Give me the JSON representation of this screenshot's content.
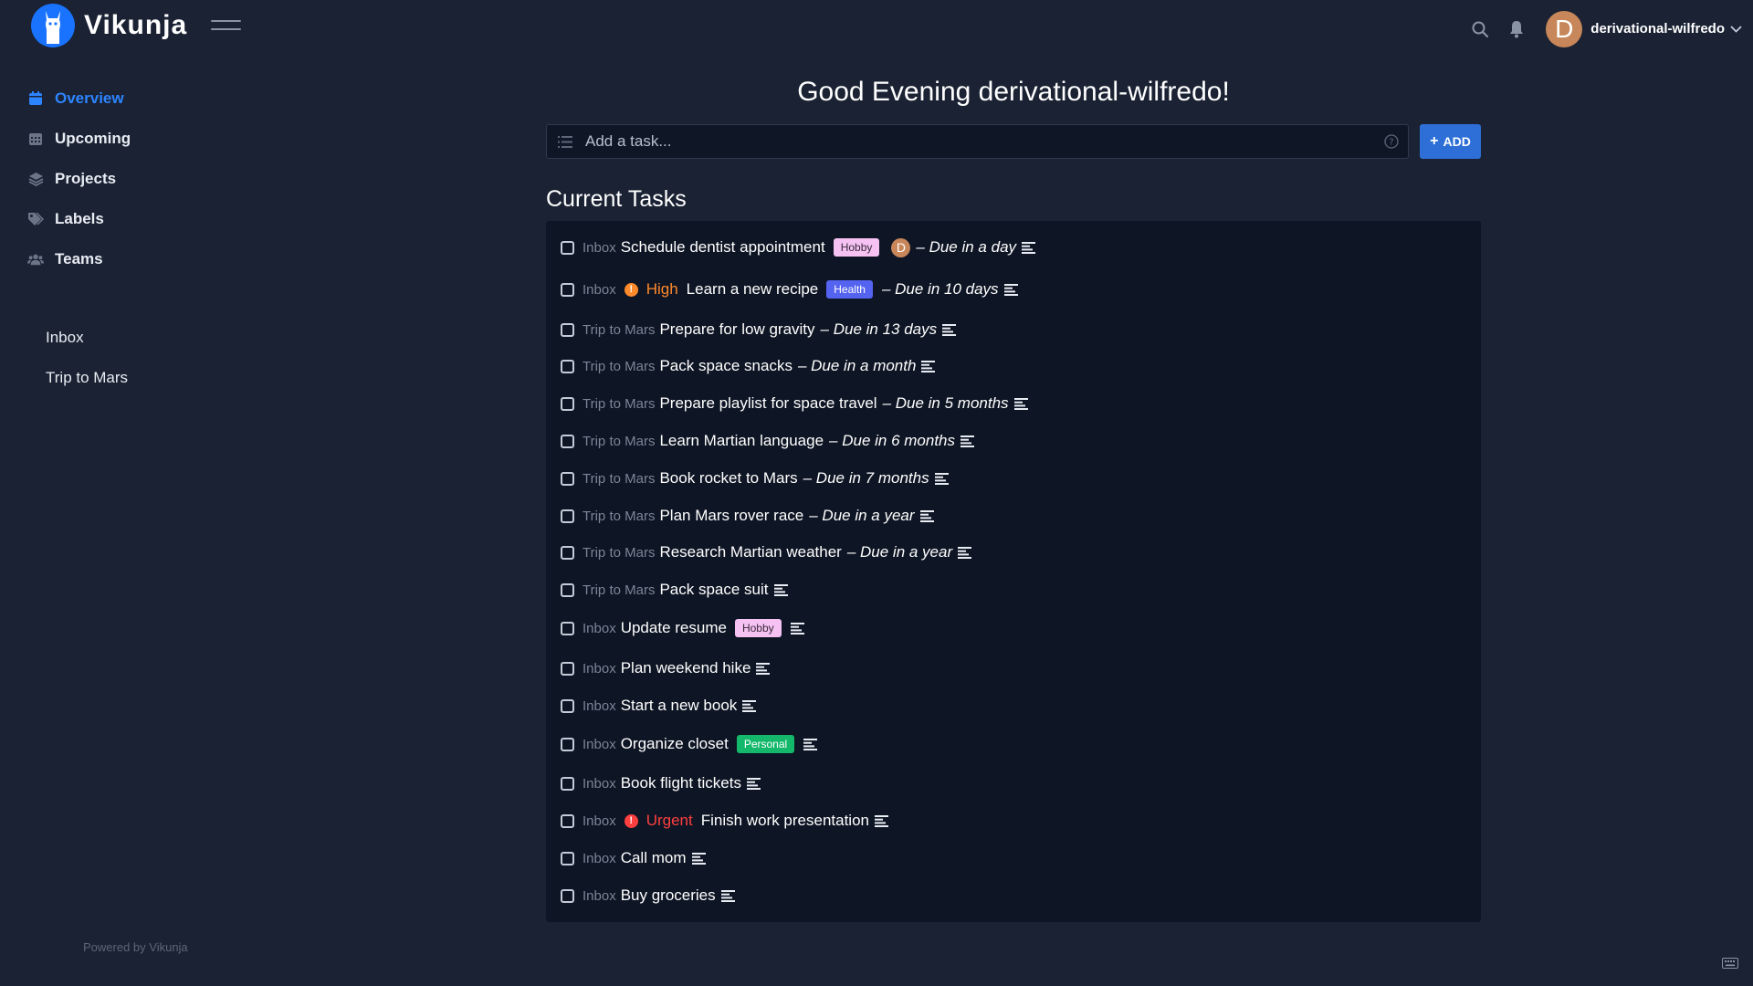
{
  "app": {
    "name": "Vikunja"
  },
  "header": {
    "username": "derivational-wilfredo",
    "avatar_letter": "D",
    "avatar_color": "#c8875a"
  },
  "nav": [
    {
      "label": "Overview",
      "icon": "calendar-icon",
      "active": true
    },
    {
      "label": "Upcoming",
      "icon": "calendar-grid-icon",
      "active": false
    },
    {
      "label": "Projects",
      "icon": "layers-icon",
      "active": false
    },
    {
      "label": "Labels",
      "icon": "tags-icon",
      "active": false
    },
    {
      "label": "Teams",
      "icon": "users-icon",
      "active": false
    }
  ],
  "projects": [
    {
      "label": "Inbox"
    },
    {
      "label": "Trip to Mars"
    }
  ],
  "footer": {
    "powered": "Powered by Vikunja"
  },
  "main": {
    "greeting": "Good Evening derivational-wilfredo!",
    "add_placeholder": "Add a task...",
    "add_button": "ADD",
    "section_title": "Current Tasks"
  },
  "colors": {
    "accent": "#2d84ff",
    "priority_high": "#ff8a2b",
    "priority_urgent": "#ff4040",
    "label_hobby": "#f5c2f3",
    "label_health": "#5463f0",
    "label_personal": "#14b86a"
  },
  "tasks": [
    {
      "project": "Inbox",
      "title": "Schedule dentist appointment",
      "label": "Hobby",
      "assignee": "D",
      "due": "– Due in a day"
    },
    {
      "project": "Inbox",
      "priority": "High",
      "title": "Learn a new recipe",
      "label": "Health",
      "due": "– Due in 10 days"
    },
    {
      "project": "Trip to Mars",
      "title": "Prepare for low gravity",
      "due": "– Due in 13 days"
    },
    {
      "project": "Trip to Mars",
      "title": "Pack space snacks",
      "due": "– Due in a month"
    },
    {
      "project": "Trip to Mars",
      "title": "Prepare playlist for space travel",
      "due": "– Due in 5 months"
    },
    {
      "project": "Trip to Mars",
      "title": "Learn Martian language",
      "due": "– Due in 6 months"
    },
    {
      "project": "Trip to Mars",
      "title": "Book rocket to Mars",
      "due": "– Due in 7 months"
    },
    {
      "project": "Trip to Mars",
      "title": "Plan Mars rover race",
      "due": "– Due in a year"
    },
    {
      "project": "Trip to Mars",
      "title": "Research Martian weather",
      "due": "– Due in a year"
    },
    {
      "project": "Trip to Mars",
      "title": "Pack space suit"
    },
    {
      "project": "Inbox",
      "title": "Update resume",
      "label": "Hobby"
    },
    {
      "project": "Inbox",
      "title": "Plan weekend hike"
    },
    {
      "project": "Inbox",
      "title": "Start a new book"
    },
    {
      "project": "Inbox",
      "title": "Organize closet",
      "label": "Personal"
    },
    {
      "project": "Inbox",
      "title": "Book flight tickets"
    },
    {
      "project": "Inbox",
      "priority": "Urgent",
      "title": "Finish work presentation"
    },
    {
      "project": "Inbox",
      "title": "Call mom"
    },
    {
      "project": "Inbox",
      "title": "Buy groceries"
    }
  ]
}
